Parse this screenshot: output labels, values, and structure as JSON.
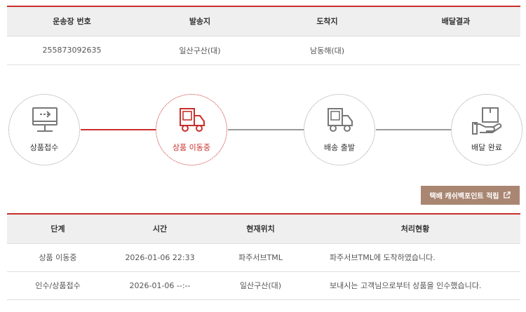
{
  "shipment": {
    "headers": [
      "운송장 번호",
      "발송지",
      "도착지",
      "배달결과"
    ],
    "row": [
      "255873092635",
      "일산구산(대)",
      "남동해(대)",
      ""
    ]
  },
  "steps": [
    {
      "label": "상품접수",
      "icon": "monitor-arrow-icon",
      "active": false
    },
    {
      "label": "상품 이동중",
      "icon": "moving-truck-icon",
      "active": true
    },
    {
      "label": "배송 출발",
      "icon": "delivery-truck-icon",
      "active": false
    },
    {
      "label": "배달 완료",
      "icon": "hand-box-icon",
      "active": false
    }
  ],
  "point_button": {
    "label": "택배 캐쉬백포인트 적립",
    "icon": "external-link-icon"
  },
  "history": {
    "headers": [
      "단계",
      "시간",
      "현재위치",
      "처리현황"
    ],
    "rows": [
      [
        "상품 이동중",
        "2026-01-06 22:33",
        "파주서브TML",
        "파주서브TML에 도착하였습니다."
      ],
      [
        "인수/상품접수",
        "2026-01-06 --:--",
        "일산구산(대)",
        "보내시는 고객님으로부터 상품을 인수했습니다."
      ]
    ]
  },
  "colors": {
    "accent": "#c8302c",
    "button_bg": "#a98672",
    "header_bg": "#efefef",
    "inactive": "#9a9a9a"
  }
}
